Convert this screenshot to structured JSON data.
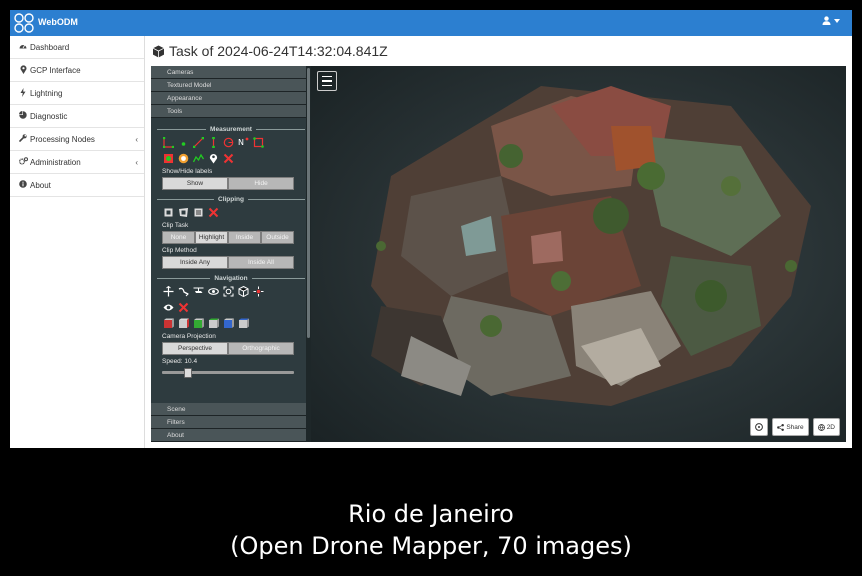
{
  "app": {
    "brand": "WebODM"
  },
  "sidebar": {
    "items": [
      {
        "label": "Dashboard",
        "icon": "dashboard-icon"
      },
      {
        "label": "GCP Interface",
        "icon": "map-marker-icon"
      },
      {
        "label": "Lightning",
        "icon": "bolt-icon"
      },
      {
        "label": "Diagnostic",
        "icon": "pie-chart-icon"
      },
      {
        "label": "Processing Nodes",
        "icon": "wrench-icon",
        "expandable": true
      },
      {
        "label": "Administration",
        "icon": "cogs-icon",
        "expandable": true
      },
      {
        "label": "About",
        "icon": "info-icon"
      }
    ]
  },
  "main": {
    "title": "Task of 2024-06-24T14:32:04.841Z"
  },
  "viewer": {
    "top_sections": [
      "Cameras",
      "Textured Model",
      "Appearance",
      "Tools"
    ],
    "measurement": {
      "header": "Measurement",
      "show_hide_label": "Show/Hide labels",
      "show": "Show",
      "hide": "Hide"
    },
    "clipping": {
      "header": "Clipping",
      "clip_task_label": "Clip Task",
      "clip_task_options": [
        "None",
        "Highlight",
        "Inside",
        "Outside"
      ],
      "clip_task_selected": "Highlight",
      "clip_method_label": "Clip Method",
      "clip_method_options": [
        "Inside Any",
        "Inside All"
      ],
      "clip_method_selected": "Inside Any"
    },
    "navigation": {
      "header": "Navigation",
      "projection_label": "Camera Projection",
      "projection_options": [
        "Perspective",
        "Orthographic"
      ],
      "projection_selected": "Perspective",
      "speed_label": "Speed: 10.4",
      "speed_fraction": 0.18
    },
    "bottom_sections": [
      "Scene",
      "Filters",
      "About"
    ],
    "buttons": {
      "share": "Share",
      "view2d": "2D"
    }
  },
  "caption": {
    "line1": "Rio de Janeiro",
    "line2": "(Open Drone Mapper, 70 images)"
  },
  "colors": {
    "topbar": "#2c7fd0",
    "panel": "#2e3b3f",
    "accordion": "#4a5558"
  }
}
